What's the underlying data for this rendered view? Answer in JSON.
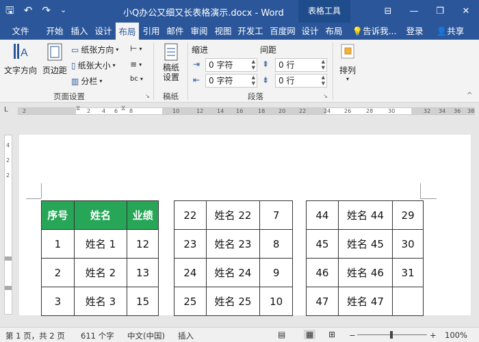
{
  "window": {
    "title": "小Q办公又细又长表格演示.docx - Word",
    "context_tools": "表格工具",
    "minimize": "—",
    "restore": "❐",
    "close": "✕",
    "ribbon_toggle": "⊟"
  },
  "qat": {
    "save": "🖫",
    "undo": "↶",
    "redo": "↷",
    "customize": "⌄"
  },
  "tabs": [
    "文件",
    "开始",
    "插入",
    "设计",
    "布局",
    "引用",
    "邮件",
    "审阅",
    "视图",
    "开发工",
    "百度网",
    "设计",
    "布局"
  ],
  "tell_me": "告诉我...",
  "login": "登录",
  "share": "共享",
  "ribbon": {
    "text_direction": "文字方向",
    "margins": "页边距",
    "orientation": "纸张方向",
    "size": "纸张大小",
    "columns": "分栏",
    "page_setup_label": "页面设置",
    "draft_paper": "稿纸设置",
    "draft_label": "稿纸",
    "indent_label": "缩进",
    "spacing_label": "间距",
    "indent_left": "0 字符",
    "indent_right": "0 字符",
    "spacing_before": "0 行",
    "spacing_after": "0 行",
    "paragraph_label": "段落",
    "arrange": "排列"
  },
  "ruler": {
    "h_numbers": [
      "2",
      "2",
      "4",
      "6",
      "8",
      "10",
      "12",
      "14",
      "16",
      "18",
      "20",
      "22",
      "24",
      "26",
      "28",
      "30",
      "32",
      "34",
      "36",
      "38"
    ],
    "v_numbers": [
      "4",
      "2",
      "2"
    ]
  },
  "table1": {
    "headers": [
      "序号",
      "姓名",
      "业绩"
    ],
    "rows": [
      [
        "1",
        "姓名 1",
        "12"
      ],
      [
        "2",
        "姓名 2",
        "13"
      ],
      [
        "3",
        "姓名 3",
        "15"
      ]
    ]
  },
  "table2": {
    "rows": [
      [
        "22",
        "姓名 22",
        "7"
      ],
      [
        "23",
        "姓名 23",
        "8"
      ],
      [
        "24",
        "姓名 24",
        "9"
      ],
      [
        "25",
        "姓名 25",
        "10"
      ]
    ]
  },
  "table3": {
    "rows": [
      [
        "44",
        "姓名 44",
        "29"
      ],
      [
        "45",
        "姓名 45",
        "30"
      ],
      [
        "46",
        "姓名 46",
        "31"
      ],
      [
        "47",
        "姓名 47",
        ""
      ]
    ]
  },
  "status": {
    "page": "第 1 页，共 2 页",
    "words": "611 个字",
    "language": "中文(中国)",
    "mode": "插入",
    "zoom": "100%",
    "zoom_minus": "−",
    "zoom_plus": "+"
  },
  "colors": {
    "accent": "#2b579a",
    "header_green": "#26a656"
  }
}
